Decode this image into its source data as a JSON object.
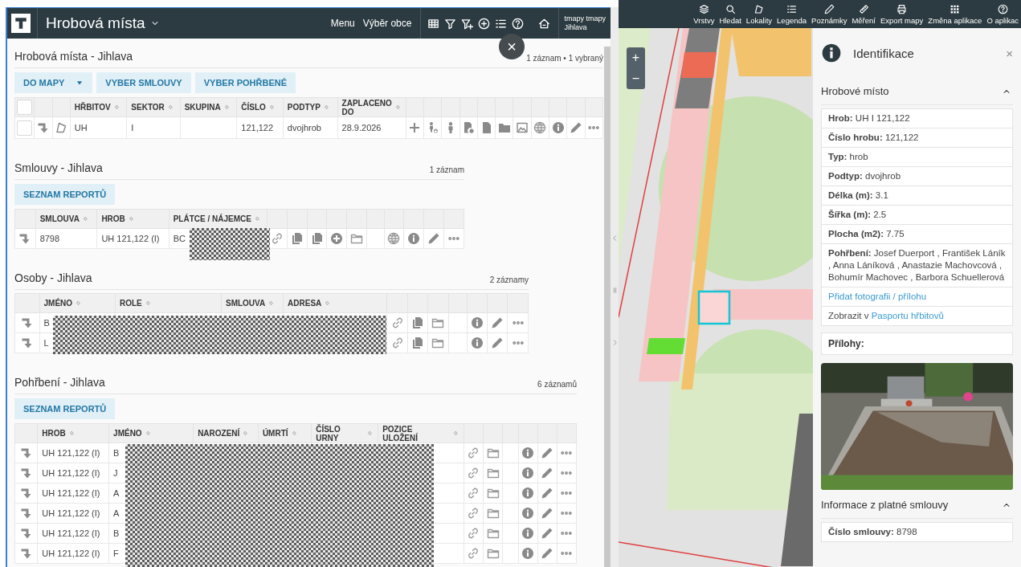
{
  "header": {
    "title": "Hrobová místa",
    "menu": "Menu",
    "municipality": "Výběr obce",
    "user": [
      "tmapy tmapy",
      "Jihlava"
    ],
    "close": "×"
  },
  "sections": [
    {
      "kind": "graves",
      "title": "Hrobová místa - Jihlava",
      "count": "1 záznam • 1 vybraný",
      "buttons": [
        {
          "label": "DO MAPY",
          "kind": "split"
        },
        {
          "label": "VYBER SMLOUVY",
          "kind": "plain"
        },
        {
          "label": "VYBER POHŘBENÉ",
          "kind": "plain"
        }
      ],
      "select_all_checked": false,
      "columns": [
        "HŘBITOV",
        "SEKTOR",
        "SKUPINA",
        "ČÍSLO",
        "PODTYP",
        "ZAPLACENO DO"
      ],
      "rows": [
        {
          "checked": false,
          "cells": [
            "UH",
            "I",
            null,
            "121,122",
            "dvojhrob",
            "28.9.2026"
          ]
        }
      ]
    },
    {
      "kind": "contracts",
      "title": "Smlouvy - Jihlava",
      "count": "1 záznam",
      "buttons": [
        {
          "label": "SEZNAM REPORTŮ",
          "kind": "plain"
        }
      ],
      "columns": [
        "SMLOUVA",
        "HROB",
        "PLÁTCE / NÁJEMCE"
      ],
      "rows": [
        {
          "cells": [
            "8798",
            "UH 121,122 (I)",
            "BC"
          ]
        }
      ]
    },
    {
      "kind": "persons",
      "title": "Osoby - Jihlava",
      "count": "2 záznamy",
      "columns": [
        "JMÉNO",
        "ROLE",
        "SMLOUVA",
        "ADRESA"
      ],
      "rows": [
        {
          "cells": [
            "B",
            null,
            null,
            null
          ]
        },
        {
          "cells": [
            "L",
            null,
            null,
            null
          ]
        }
      ]
    },
    {
      "kind": "burials",
      "title": "Pohřbení - Jihlava",
      "count": "6 záznamů",
      "buttons": [
        {
          "label": "SEZNAM REPORTŮ",
          "kind": "plain"
        }
      ],
      "columns": [
        "HROB",
        "JMÉNO",
        "NAROZENÍ",
        "ÚMRTÍ",
        "ČÍSLO URNY",
        "POZICE ULOŽENÍ"
      ],
      "rows": [
        {
          "cells": [
            "UH 121,122 (I)",
            "B",
            null,
            null,
            null,
            null
          ]
        },
        {
          "cells": [
            "UH 121,122 (I)",
            "J",
            null,
            null,
            null,
            null
          ]
        },
        {
          "cells": [
            "UH 121,122 (I)",
            "A",
            null,
            null,
            null,
            null
          ]
        },
        {
          "cells": [
            "UH 121,122 (I)",
            "A",
            null,
            null,
            null,
            null
          ]
        },
        {
          "cells": [
            "UH 121,122 (I)",
            "B",
            null,
            null,
            null,
            null
          ]
        },
        {
          "cells": [
            "UH 121,122 (I)",
            "F",
            null,
            null,
            null,
            null
          ]
        }
      ]
    }
  ],
  "map_toolbar": [
    {
      "label": "Vrstvy",
      "kind": "layers"
    },
    {
      "label": "Hledat",
      "kind": "search"
    },
    {
      "label": "Lokality",
      "kind": "polygon"
    },
    {
      "label": "Legenda",
      "kind": "list"
    },
    {
      "label": "Poznámky",
      "kind": "pencil"
    },
    {
      "label": "Měření",
      "kind": "ruler"
    },
    {
      "label": "Export mapy",
      "kind": "printer"
    },
    {
      "label": "Změna aplikace",
      "kind": "grid"
    },
    {
      "label": "O aplikac",
      "kind": "help"
    }
  ],
  "map": {
    "zoom_in": "+",
    "zoom_out": "−"
  },
  "identification": {
    "title": "Identifikace",
    "close": "×",
    "section": "Hrobové místo",
    "section_expanded": true,
    "properties": [
      "**Hrob:** UH I 121,122",
      "**Číslo hrobu:** 121,122",
      "**Typ:** hrob",
      "**Podtyp:** dvojhrob",
      "**Délka (m):** 3.1",
      "**Šířka (m):** 2.5",
      "**Plocha (m2):** 7.75",
      "**Pohřbení:** Josef Duerport , František Láník , Anna Láníková , Anastazie Machovcová , Bohumír Machovec , Barbora Schuellerová"
    ],
    "add_link": "Přidat fotografii / přílohu",
    "show_prefix": "Zobrazit v",
    "show_link": "Pasportu hřbitovů",
    "attachments": "Přílohy:",
    "photo": {
      "kind": "picture"
    },
    "contract_section": "Informace z platné smlouvy",
    "contract_expanded": true,
    "contract_properties": [
      "**Číslo smlouvy:** 8798"
    ]
  }
}
